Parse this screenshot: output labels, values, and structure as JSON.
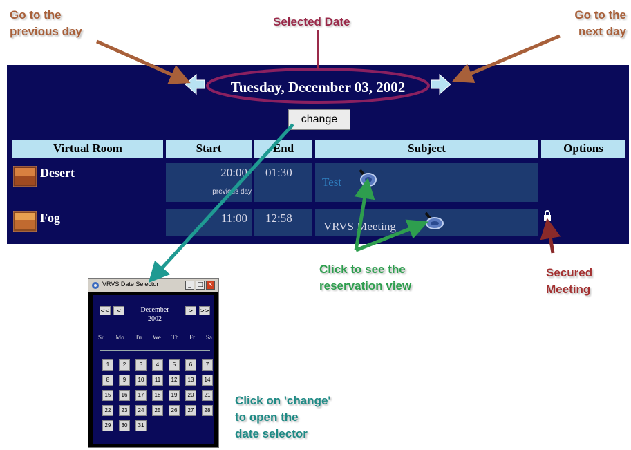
{
  "annotations": {
    "prev_day": [
      "Go to the",
      "previous day"
    ],
    "selected_date": "Selected Date",
    "next_day": [
      "Go to the",
      "next day"
    ],
    "reservation_view": [
      "Click to see the",
      "reservation view"
    ],
    "secured": [
      "Secured",
      "Meeting"
    ],
    "date_selector_hint": [
      "Click on 'change'",
      "to open the",
      "date selector"
    ]
  },
  "app": {
    "date": "Tuesday, December 03, 2002",
    "change_label": "change",
    "columns": [
      "Virtual Room",
      "Start",
      "End",
      "Subject",
      "Options"
    ],
    "rows": [
      {
        "room": "Desert",
        "start": "20:00",
        "start_note": "previous day",
        "end": "01:30",
        "subject": "Test",
        "secured": false
      },
      {
        "room": "Fog",
        "start": "11:00",
        "start_note": "",
        "end": "12:58",
        "subject": "VRVS Meeting",
        "secured": true
      }
    ]
  },
  "calendar": {
    "window_title": "VRVS Date Selector",
    "nav": {
      "prev_year": "<<",
      "prev_month": "<",
      "next_month": ">",
      "next_year": ">>"
    },
    "month": "December",
    "year": "2002",
    "weekdays": [
      "Su",
      "Mo",
      "Tu",
      "We",
      "Th",
      "Fr",
      "Sa"
    ],
    "days": [
      "1",
      "2",
      "3",
      "4",
      "5",
      "6",
      "7",
      "8",
      "9",
      "10",
      "11",
      "12",
      "13",
      "14",
      "15",
      "16",
      "17",
      "18",
      "19",
      "20",
      "21",
      "22",
      "23",
      "24",
      "25",
      "26",
      "27",
      "28",
      "29",
      "30",
      "31"
    ]
  },
  "colors": {
    "panel_bg": "#0a0a5a",
    "header_bg": "#b8e2f2",
    "cell_bg": "#1d3a70",
    "arrow_brown": "#a8603a",
    "arrow_teal": "#1f9a92",
    "arrow_green": "#2e9e4e",
    "arrow_maroon": "#9a2a4a"
  }
}
